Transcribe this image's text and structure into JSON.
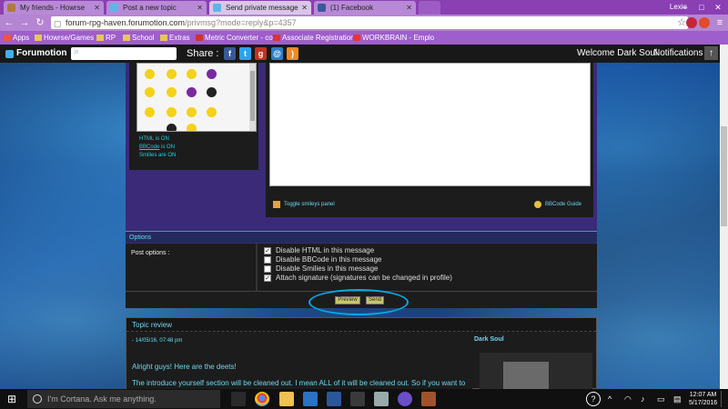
{
  "browser": {
    "tabs": [
      {
        "title": "My friends - Howrse",
        "active": false
      },
      {
        "title": "Post a new topic",
        "active": false
      },
      {
        "title": "Send private message",
        "active": true
      },
      {
        "title": "(1) Facebook",
        "active": false
      }
    ],
    "user": "Lexie",
    "url": {
      "host": "forum-rpg-haven.forumotion.com",
      "path": "/privmsg?mode=reply&p=4357"
    },
    "bookmarks": [
      "Apps",
      "Howrse/Games",
      "RP",
      "School",
      "Extras",
      "Metric Converter - co",
      "Associate Registration",
      "WORKBRAIN - Emplo"
    ]
  },
  "forum_toolbar": {
    "brand": "Forumotion",
    "share_label": "Share :",
    "welcome": "Welcome Dark Soul",
    "notifications": "Notifications"
  },
  "editor": {
    "status_lines": {
      "html": "HTML is ON",
      "bbcode_link": "BBCode",
      "bbcode_suffix": " is ON",
      "smilies": "Smilies are ON"
    },
    "toggle_smileys": "Toggle smileys panel",
    "bbcode_guide": "BBCode Guide"
  },
  "options": {
    "heading": "Options",
    "label": "Post options :",
    "items": [
      {
        "label": "Disable HTML in this message",
        "checked": true
      },
      {
        "label": "Disable BBCode in this message",
        "checked": false
      },
      {
        "label": "Disable Smilies in this message",
        "checked": false
      },
      {
        "label": "Attach signature (signatures can be changed in profile)",
        "checked": true
      }
    ],
    "preview_button": "Preview",
    "send_button": "Send"
  },
  "topic_review": {
    "heading": "Topic review",
    "date": "- 14/05/16, 07:48 pm",
    "author": "Dark Soul",
    "lines": [
      "Alright guys! Here are the deets!",
      "The introduce yourself section will be cleaned out. I mean ALL of it will be cleaned out. So if you want to"
    ]
  },
  "taskbar": {
    "search_placeholder": "I'm Cortana. Ask me anything.",
    "time": "12:07 AM",
    "date": "5/17/2016"
  },
  "colors": {
    "accent": "#8a3fb3",
    "link": "#6bd8f0",
    "panel": "#1c1c1c",
    "highlight_oval": "#0aa5e8"
  }
}
